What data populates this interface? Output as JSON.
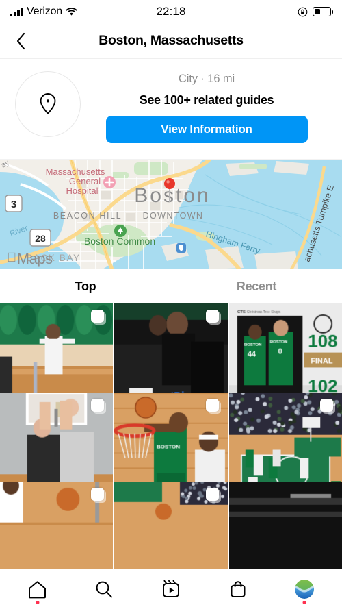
{
  "status_bar": {
    "carrier": "Verizon",
    "signal_icon": "cellular-bars-icon",
    "wifi_icon": "wifi-icon",
    "time": "22:18",
    "rotation_lock_icon": "rotation-lock-icon",
    "battery_icon": "battery-icon",
    "battery_level_pct": 40
  },
  "header": {
    "back_icon": "chevron-left-icon",
    "title": "Boston, Massachusetts"
  },
  "info": {
    "location_icon": "map-pin-icon",
    "meta": "City · 16 mi",
    "guides_label": "See 100+ related guides",
    "view_information_label": "View Information",
    "accent_color": "#0095f6"
  },
  "map": {
    "attribution": "Maps",
    "apple_logo_icon": "apple-logo-icon",
    "pin_icon": "map-marker-pin-icon",
    "pin_color": "#e8372c",
    "labels": [
      "Massachusetts General Hospital",
      "Boston",
      "BEACON HILL",
      "DOWNTOWN",
      "Boston Common",
      "BACK BAY",
      "Hingham Ferry",
      "Massachusetts Turnpike E",
      "River",
      "3",
      "28"
    ],
    "hospital_icon": "hospital-cross-icon",
    "park_icon": "park-tree-icon",
    "transit_icon": "transit-station-icon",
    "water_color": "#a8dcf0",
    "land_color": "#f2efe9",
    "park_color": "#cfe8c5",
    "road_color": "#ffffff",
    "highway_color": "#fbd98d"
  },
  "tabs": [
    {
      "label": "Top",
      "active": true
    },
    {
      "label": "Recent",
      "active": false
    }
  ],
  "grid": {
    "posts": [
      {
        "name": "post-celebrating-player",
        "multi": true,
        "description": "Basketball player in white jersey number 25 celebrating on court",
        "palette": [
          "#1d7a4a",
          "#e9d3b4",
          "#c98b4a",
          "#f2f2f2"
        ]
      },
      {
        "name": "post-courtside-fans",
        "multi": true,
        "description": "Two women in black outfits seated courtside in JetBlue chairs",
        "palette": [
          "#111111",
          "#2a2a2a",
          "#e8e8e8",
          "#1d7a4a"
        ]
      },
      {
        "name": "post-final-score-graphic",
        "multi": false,
        "description": "Celtics final score graphic 108 to 102 Celtics Win",
        "palette": [
          "#e9e9e9",
          "#0d7a3e",
          "#b79256",
          "#1a1a1a"
        ]
      },
      {
        "name": "post-keys-handoff",
        "multi": true,
        "description": "Two people indoors holding up keys in front of window",
        "palette": [
          "#b9bcbd",
          "#e9e4de",
          "#2a2a2a",
          "#c98b4a"
        ]
      },
      {
        "name": "post-layup-at-rim",
        "multi": true,
        "description": "Celtics player driving to the hoop past a defender",
        "palette": [
          "#d9a063",
          "#0d7a3e",
          "#d83a2a",
          "#f0f0f0"
        ]
      },
      {
        "name": "post-court-wide-view",
        "multi": true,
        "description": "Wide overhead view of the green painted court with crowd",
        "palette": [
          "#2b2a3a",
          "#1d7a4a",
          "#d9a063",
          "#cfd3dd"
        ]
      },
      {
        "name": "post-partial-player-bottom",
        "multi": true,
        "description": "Partially visible player on hardwood court with basketball",
        "palette": [
          "#d9a063",
          "#ffffff",
          "#c96a2a"
        ]
      },
      {
        "name": "post-partial-court-bottom",
        "multi": true,
        "description": "Partially visible arena court from stands",
        "palette": [
          "#d9a063",
          "#1d7a4a",
          "#2b2a3a"
        ]
      },
      {
        "name": "post-partial-dark-bottom",
        "multi": false,
        "description": "Partially visible dark arena seating",
        "palette": [
          "#111111",
          "#333333",
          "#888888"
        ]
      }
    ]
  },
  "bottom_nav": {
    "items": [
      {
        "name": "nav-home",
        "icon": "home-icon",
        "badge": true
      },
      {
        "name": "nav-search",
        "icon": "search-icon",
        "badge": false
      },
      {
        "name": "nav-reels",
        "icon": "reels-icon",
        "badge": false
      },
      {
        "name": "nav-shop",
        "icon": "shop-bag-icon",
        "badge": false
      },
      {
        "name": "nav-profile",
        "icon": "profile-avatar-icon",
        "badge": true
      }
    ],
    "badge_color": "#ff3250"
  }
}
